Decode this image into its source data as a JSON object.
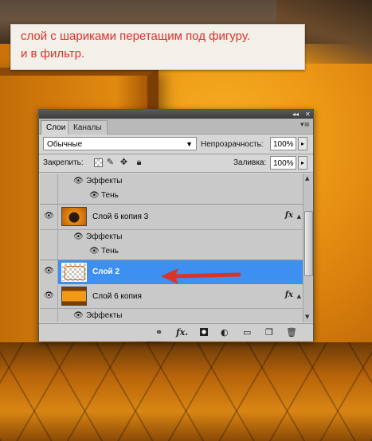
{
  "annotation": {
    "line1": "слой с шариками перетащим под фигуру.",
    "line2": "и в фильтр.",
    "color": "#e0302a"
  },
  "panel": {
    "titlebar": {
      "collapse_icon": "double-chevron-icon",
      "close_icon": "close-icon"
    },
    "tabs": [
      {
        "label": "Слои",
        "active": true
      },
      {
        "label": "Каналы",
        "active": false
      }
    ],
    "blend_mode": {
      "value": "Обычные"
    },
    "opacity": {
      "label": "Непрозрачность:",
      "value": "100%"
    },
    "lock": {
      "label": "Закрепить:"
    },
    "fill": {
      "label": "Заливка:",
      "value": "100%"
    },
    "rows": [
      {
        "type": "effects",
        "label": "Эффекты"
      },
      {
        "type": "effect",
        "label": "Тень"
      },
      {
        "type": "layer",
        "name": "Слой 6 копия 3",
        "fx": "fx",
        "selected": false
      },
      {
        "type": "effects",
        "label": "Эффекты"
      },
      {
        "type": "effect",
        "label": "Тень"
      },
      {
        "type": "layer",
        "name": "Слой 2",
        "selected": true
      },
      {
        "type": "layer",
        "name": "Слой 6 копия",
        "fx": "fx",
        "selected": false
      },
      {
        "type": "effects",
        "label": "Эффекты"
      }
    ],
    "selected_color": "#3d8ff0",
    "bottom_icons": [
      "link-icon",
      "fx-icon",
      "mask-icon",
      "adjustment-icon",
      "folder-icon",
      "new-layer-icon",
      "trash-icon"
    ]
  }
}
